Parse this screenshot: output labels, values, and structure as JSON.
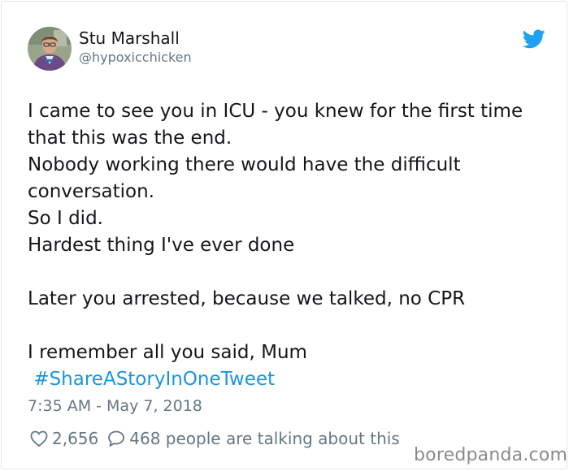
{
  "tweet": {
    "author_name": "Stu Marshall",
    "author_handle": "@hypoxicchicken",
    "lines": [
      "I came to see you in ICU - you knew for the first time",
      "that this was the end.",
      "Nobody working there would have the difficult",
      "conversation.",
      "So I did.",
      "Hardest thing I've ever done",
      "",
      "Later you arrested, because we talked, no CPR",
      "",
      "I remember all you said, Mum"
    ],
    "hashtag": "#ShareAStoryInOneTweet",
    "timestamp": "7:35 AM - May 7, 2018",
    "likes": "2,656",
    "replies_text": "468 people are talking about this"
  },
  "icons": {
    "bird": "twitter-bird-icon",
    "like": "heart-icon",
    "reply": "speech-bubble-icon"
  },
  "colors": {
    "link": "#1b95e0",
    "twitter_blue": "#1da1f2",
    "muted": "#657786",
    "text": "#14171a"
  },
  "watermark": "boredpanda.com"
}
